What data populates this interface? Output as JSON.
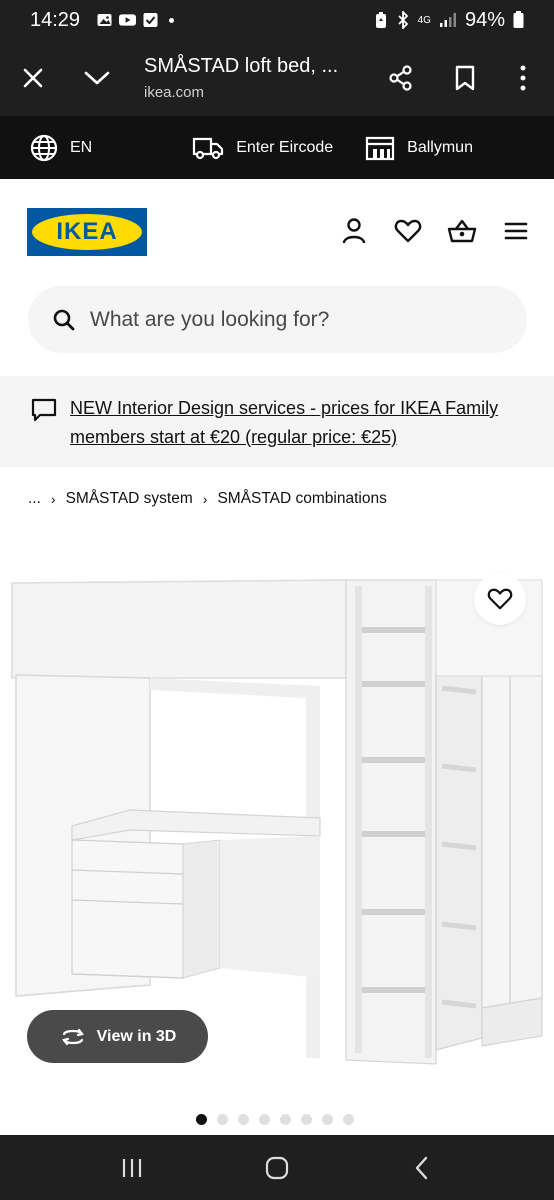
{
  "status_bar": {
    "time": "14:29",
    "network": "4G",
    "battery": "94%"
  },
  "browser": {
    "page_title": "SMÅSTAD loft bed, ...",
    "url": "ikea.com",
    "icons": [
      "close-icon",
      "chevron-down-icon",
      "share-icon",
      "bookmark-icon",
      "more-icon"
    ]
  },
  "locale_bar": {
    "language": "EN",
    "eircode": "Enter Eircode",
    "store": "Ballymun"
  },
  "header": {
    "logo_text": "IKEA",
    "icons": [
      "profile-icon",
      "heart-icon",
      "basket-icon",
      "menu-icon"
    ]
  },
  "search": {
    "placeholder": "What are you looking for?"
  },
  "promo": {
    "text": "NEW Interior Design services - prices for IKEA Family members start at €20 (regular price: €25)"
  },
  "breadcrumb": {
    "ellipsis": "...",
    "items": [
      "SMÅSTAD system",
      "SMÅSTAD combinations"
    ]
  },
  "product": {
    "view_3d_label": "View in 3D",
    "image_count": 8,
    "active_image": 1
  },
  "colors": {
    "ikea_blue": "#0058a3",
    "ikea_yellow": "#ffdb00",
    "dark_bar": "#111111"
  }
}
